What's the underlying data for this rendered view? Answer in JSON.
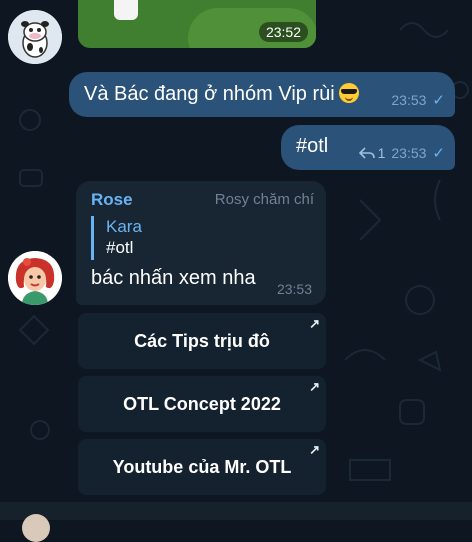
{
  "messages": {
    "media": {
      "time": "23:52"
    },
    "outgoing_1": {
      "text": "Và Bác đang ở nhóm Vip rùi",
      "emoji": "sunglasses-emoji",
      "time": "23:53"
    },
    "outgoing_2": {
      "text": "#otl",
      "reply_count": "1",
      "time": "23:53"
    },
    "incoming": {
      "sender": "Rose",
      "sender_title": "Rosy chăm chí",
      "quote_name": "Kara",
      "quote_text": "#otl",
      "text": "bác nhấn xem nha",
      "time": "23:53"
    }
  },
  "inline_buttons": [
    {
      "label": "Các Tips trịu đô",
      "icon": "external-arrow-icon"
    },
    {
      "label": "OTL Concept 2022",
      "icon": "external-arrow-icon"
    },
    {
      "label": "Youtube của Mr. OTL",
      "icon": "external-arrow-icon"
    }
  ],
  "colors": {
    "background": "#0e1621",
    "outgoing_bubble": "#2b5278",
    "incoming_bubble": "#182533",
    "accent": "#6ab3f3"
  }
}
